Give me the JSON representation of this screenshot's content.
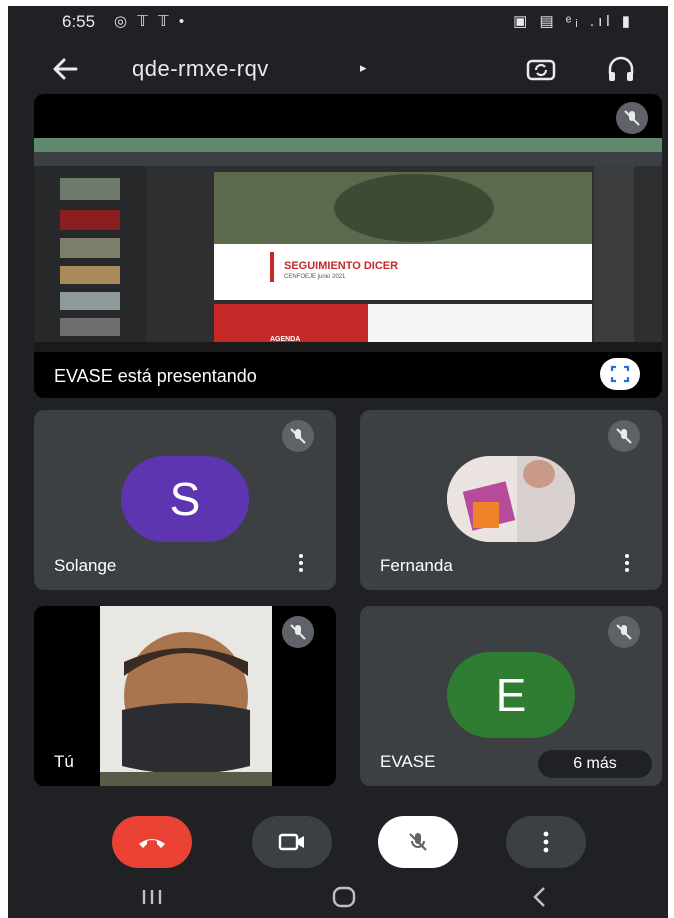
{
  "status_bar": {
    "time": "6:55",
    "left_icons": "◎ 𝕋 𝕋 •",
    "right_icons": "▣ ▤ ᵉᵢ .ıl ▮"
  },
  "topbar": {
    "meeting_code": "qde-rmxe-rqv",
    "caret": "▸"
  },
  "presentation": {
    "caption": "EVASE está presentando",
    "slide_title": "SEGUIMIENTO DICER",
    "slide_subtitle": "CENFOEJE junio 2021",
    "agenda_label": "AGENDA"
  },
  "participants": [
    {
      "name": "Solange",
      "initial": "S",
      "color": "#5e35b1"
    },
    {
      "name": "Fernanda"
    },
    {
      "name": "Tú"
    },
    {
      "name": "EVASE",
      "initial": "E",
      "color": "#2e7d32"
    }
  ],
  "more_count": "6 más",
  "colors": {
    "background": "#202124",
    "tile": "#3c4043",
    "end_call": "#ea4335"
  }
}
